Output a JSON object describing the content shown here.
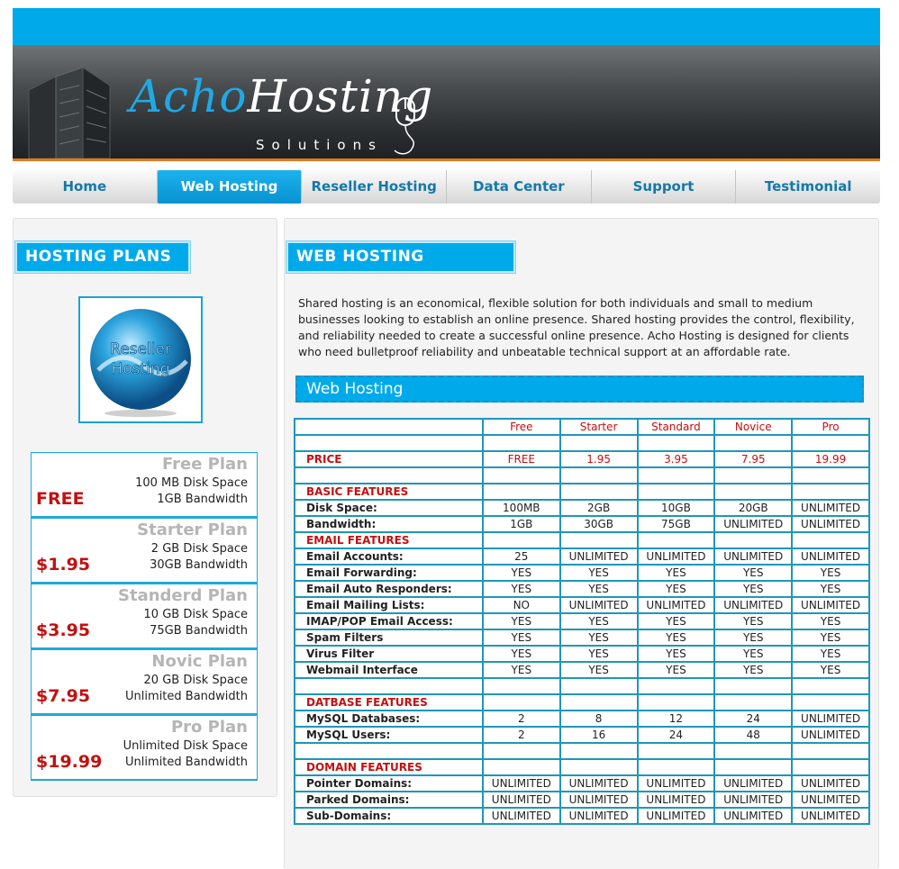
{
  "brand": {
    "name_part1": "Acho",
    "name_part2": "Hosting",
    "tagline": "Solutions"
  },
  "nav": [
    {
      "label": "Home",
      "active": false
    },
    {
      "label": "Web Hosting",
      "active": true
    },
    {
      "label": "Reseller Hosting",
      "active": false
    },
    {
      "label": "Data Center",
      "active": false
    },
    {
      "label": "Support",
      "active": false
    },
    {
      "label": "Testimonial",
      "active": false
    }
  ],
  "sidebar": {
    "heading": "HOSTING PLANS",
    "promo_text": [
      "Reseller",
      "Hosting"
    ],
    "plans": [
      {
        "name": "Free Plan",
        "line1": "100 MB Disk Space",
        "line2": "1GB Bandwidth",
        "price": "FREE"
      },
      {
        "name": "Starter Plan",
        "line1": "2 GB Disk Space",
        "line2": "30GB Bandwidth",
        "price": "$1.95"
      },
      {
        "name": "Standerd Plan",
        "line1": "10 GB Disk Space",
        "line2": "75GB Bandwidth",
        "price": "$3.95"
      },
      {
        "name": "Novic Plan",
        "line1": "20 GB Disk Space",
        "line2": "Unlimited Bandwidth",
        "price": "$7.95"
      },
      {
        "name": "Pro Plan",
        "line1": "Unlimited Disk Space",
        "line2": "Unlimited Bandwidth",
        "price": "$19.99"
      }
    ]
  },
  "main": {
    "heading": "WEB HOSTING",
    "intro": "Shared hosting is an economical, flexible solution for both individuals and small to medium businesses looking to establish an online presence. Shared hosting provides the control, flexibility, and reliability needed to create a successful online presence. Acho Hosting is designed for clients who need bulletproof reliability and unbeatable technical support at an affordable rate.",
    "table_title": "Web Hosting",
    "columns": [
      "Free",
      "Starter",
      "Standard",
      "Novice",
      "Pro"
    ],
    "rows": [
      {
        "type": "blank"
      },
      {
        "type": "price",
        "label": "PRICE",
        "values": [
          "FREE",
          "1.95",
          "3.95",
          "7.95",
          "19.99"
        ]
      },
      {
        "type": "blank"
      },
      {
        "type": "section",
        "label": "BASIC FEATURES"
      },
      {
        "type": "row",
        "label": "Disk Space:",
        "values": [
          "100MB",
          "2GB",
          "10GB",
          "20GB",
          "UNLIMITED"
        ]
      },
      {
        "type": "row",
        "label": "Bandwidth:",
        "values": [
          "1GB",
          "30GB",
          "75GB",
          "UNLIMITED",
          "UNLIMITED"
        ]
      },
      {
        "type": "section",
        "label": "EMAIL FEATURES"
      },
      {
        "type": "row",
        "label": "Email Accounts:",
        "values": [
          "25",
          "UNLIMITED",
          "UNLIMITED",
          "UNLIMITED",
          "UNLIMITED"
        ]
      },
      {
        "type": "row",
        "label": "Email Forwarding:",
        "values": [
          "YES",
          "YES",
          "YES",
          "YES",
          "YES"
        ]
      },
      {
        "type": "row",
        "label": "Email Auto Responders:",
        "values": [
          "YES",
          "YES",
          "YES",
          "YES",
          "YES"
        ]
      },
      {
        "type": "row",
        "label": "Email Mailing Lists:",
        "values": [
          "NO",
          "UNLIMITED",
          "UNLIMITED",
          "UNLIMITED",
          "UNLIMITED"
        ]
      },
      {
        "type": "row",
        "label": "IMAP/POP Email Access:",
        "values": [
          "YES",
          "YES",
          "YES",
          "YES",
          "YES"
        ]
      },
      {
        "type": "row",
        "label": "Spam Filters",
        "values": [
          "YES",
          "YES",
          "YES",
          "YES",
          "YES"
        ]
      },
      {
        "type": "row",
        "label": "Virus Filter",
        "values": [
          "YES",
          "YES",
          "YES",
          "YES",
          "YES"
        ]
      },
      {
        "type": "row",
        "label": "Webmail Interface",
        "values": [
          "YES",
          "YES",
          "YES",
          "YES",
          "YES"
        ]
      },
      {
        "type": "blank"
      },
      {
        "type": "section",
        "label": "DATBASE FEATURES"
      },
      {
        "type": "row",
        "label": "MySQL Databases:",
        "values": [
          "2",
          "8",
          "12",
          "24",
          "UNLIMITED"
        ]
      },
      {
        "type": "row",
        "label": "MySQL Users:",
        "values": [
          "2",
          "16",
          "24",
          "48",
          "UNLIMITED"
        ]
      },
      {
        "type": "blank"
      },
      {
        "type": "section",
        "label": "DOMAIN FEATURES"
      },
      {
        "type": "row",
        "label": "Pointer Domains:",
        "values": [
          "UNLIMITED",
          "UNLIMITED",
          "UNLIMITED",
          "UNLIMITED",
          "UNLIMITED"
        ]
      },
      {
        "type": "row",
        "label": "Parked Domains:",
        "values": [
          "UNLIMITED",
          "UNLIMITED",
          "UNLIMITED",
          "UNLIMITED",
          "UNLIMITED"
        ]
      },
      {
        "type": "row",
        "label": "Sub-Domains:",
        "values": [
          "UNLIMITED",
          "UNLIMITED",
          "UNLIMITED",
          "UNLIMITED",
          "UNLIMITED"
        ]
      }
    ]
  },
  "colors": {
    "accent": "#00aaea",
    "price_red": "#c41010",
    "table_border": "#1e97b8"
  }
}
